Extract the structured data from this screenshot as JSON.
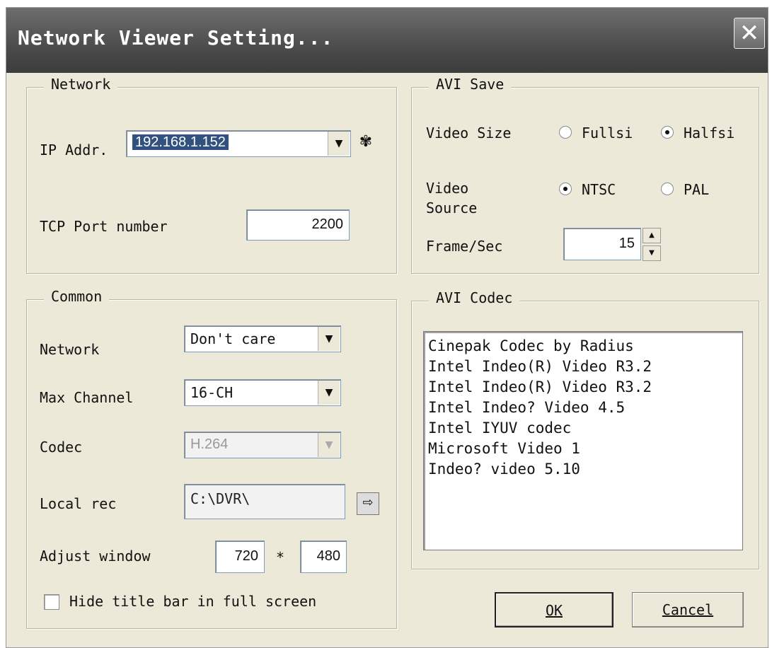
{
  "window": {
    "title": "Network Viewer Setting...",
    "close_glyph": "✕"
  },
  "network": {
    "legend": "Network",
    "ip_label": "IP Addr.",
    "ip_value": "192.168.1.152",
    "ip_icon": "network-icon",
    "port_label": "TCP Port number",
    "port_value": "2200"
  },
  "avi_save": {
    "legend": "AVI Save",
    "video_size_label": "Video Size",
    "size_full": "Fullsi",
    "size_half": "Halfsi",
    "size_selected": "Halfsi",
    "video_source_label": "Video Source",
    "source_ntsc": "NTSC",
    "source_pal": "PAL",
    "source_selected": "NTSC",
    "fps_label": "Frame/Sec",
    "fps_value": "15"
  },
  "common": {
    "legend": "Common",
    "network_label": "Network",
    "network_value": "Don't care",
    "max_channel_label": "Max Channel",
    "max_channel_value": "16-CH",
    "codec_label": "Codec",
    "codec_value": "H.264",
    "local_rec_label": "Local rec",
    "local_rec_value": "C:\\DVR\\",
    "adjust_label": "Adjust window",
    "adjust_width": "720",
    "adjust_sep": "*",
    "adjust_height": "480",
    "hide_title_label": "Hide title bar in full screen",
    "hide_title_checked": false
  },
  "avi_codec": {
    "legend": "AVI Codec",
    "items": [
      "Cinepak Codec by Radius",
      "Intel Indeo(R) Video R3.2",
      "Intel Indeo(R) Video R3.2",
      "Intel Indeo? Video 4.5",
      "Intel IYUV codec",
      "Microsoft Video 1",
      "Indeo? video 5.10"
    ]
  },
  "buttons": {
    "ok": "OK",
    "cancel": "Cancel"
  },
  "colors": {
    "titlebar": "#4c4c4c",
    "dialog_bg": "#ece9d8",
    "selection": "#31517f"
  }
}
